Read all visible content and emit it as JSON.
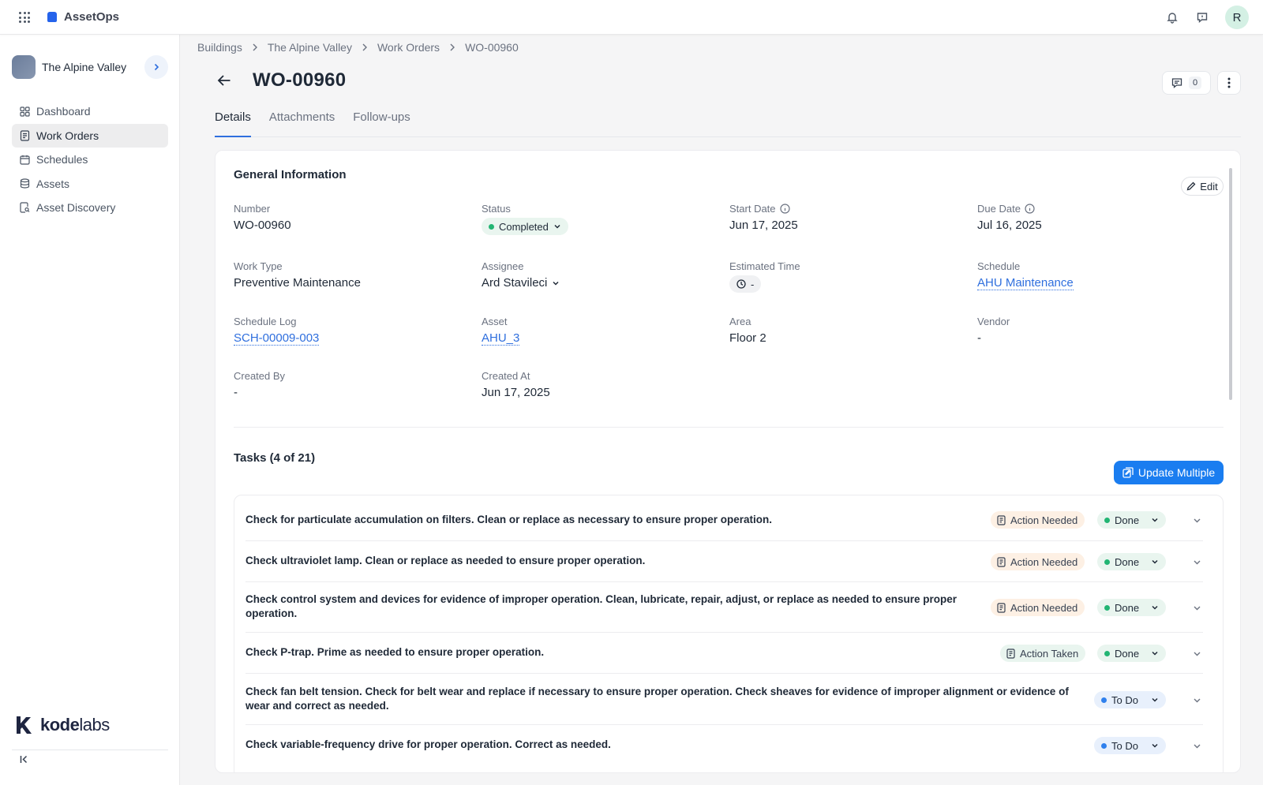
{
  "topbar": {
    "app_name": "AssetOps",
    "avatar_initial": "R"
  },
  "sidebar": {
    "site_name": "The Alpine Valley",
    "items": [
      {
        "label": "Dashboard",
        "icon": "dashboard-icon"
      },
      {
        "label": "Work Orders",
        "icon": "document-icon",
        "active": true
      },
      {
        "label": "Schedules",
        "icon": "calendar-icon"
      },
      {
        "label": "Assets",
        "icon": "stack-icon"
      },
      {
        "label": "Asset Discovery",
        "icon": "discovery-icon"
      }
    ],
    "footer_brand_bold": "kode",
    "footer_brand_light": "labs"
  },
  "breadcrumb": [
    "Buildings",
    "The Alpine Valley",
    "Work Orders",
    "WO-00960"
  ],
  "header": {
    "title": "WO-00960",
    "comment_count": "0"
  },
  "tabs": [
    "Details",
    "Attachments",
    "Follow-ups"
  ],
  "general": {
    "title": "General Information",
    "edit_label": "Edit",
    "number_label": "Number",
    "number": "WO-00960",
    "status_label": "Status",
    "status": "Completed",
    "start_label": "Start Date",
    "start": "Jun 17, 2025",
    "due_label": "Due Date",
    "due": "Jul 16, 2025",
    "worktype_label": "Work Type",
    "worktype": "Preventive Maintenance",
    "assignee_label": "Assignee",
    "assignee": "Ard Stavileci",
    "est_label": "Estimated Time",
    "est": "-",
    "schedule_label": "Schedule",
    "schedule": "AHU Maintenance",
    "schedlog_label": "Schedule Log",
    "schedlog": "SCH-00009-003",
    "asset_label": "Asset",
    "asset": "AHU_3",
    "area_label": "Area",
    "area": "Floor 2",
    "vendor_label": "Vendor",
    "vendor": "-",
    "createdby_label": "Created By",
    "createdby": "-",
    "createdat_label": "Created At",
    "createdat": "Jun 17, 2025"
  },
  "tasks": {
    "title": "Tasks (4 of 21)",
    "update_label": "Update Multiple",
    "items": [
      {
        "text": "Check for particulate accumulation on filters. Clean or replace as necessary to ensure proper operation.",
        "action": "Action Needed",
        "state": "Done"
      },
      {
        "text": "Check ultraviolet lamp. Clean or replace as needed to ensure proper operation.",
        "action": "Action Needed",
        "state": "Done"
      },
      {
        "text": "Check control system and devices for evidence of improper operation. Clean, lubricate, repair, adjust, or replace as needed to ensure proper operation.",
        "action": "Action Needed",
        "state": "Done"
      },
      {
        "text": "Check P-trap. Prime as needed to ensure proper operation.",
        "action": "Action Taken",
        "state": "Done"
      },
      {
        "text": "Check fan belt tension. Check for belt wear and replace if necessary to ensure proper operation. Check sheaves for evidence of improper alignment or evidence of wear and correct as needed.",
        "action": "",
        "state": "To Do"
      },
      {
        "text": "Check variable-frequency drive for proper operation. Correct as needed.",
        "action": "",
        "state": "To Do"
      }
    ]
  },
  "colors": {
    "accent": "#2f6fde",
    "done_dot": "#22b573",
    "todo_dot": "#2f80ed",
    "primary_button": "#1a7df0"
  }
}
